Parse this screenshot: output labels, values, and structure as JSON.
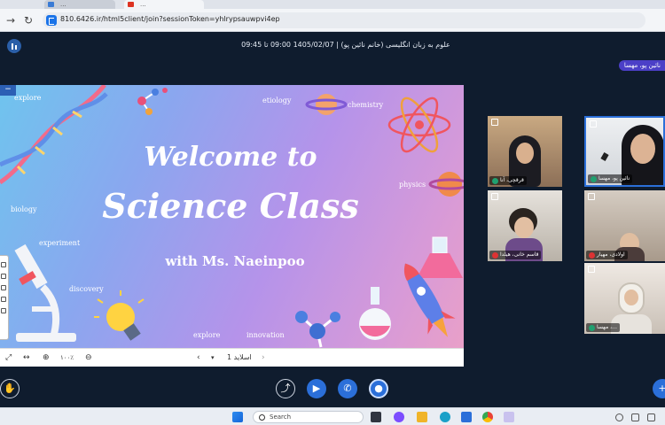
{
  "browser": {
    "tabs": [
      "...",
      "..."
    ],
    "url": "810.6426.ir/html5client/join?sessionToken=yhlrypsauwpvi4ep"
  },
  "header": {
    "session_title": "علوم به زبان انگلیسی (خانم نائین پو) | 1405/02/07 09:00 تا 09:45",
    "user_badge": "نائین پو، مهسا"
  },
  "slide": {
    "title_line1": "Welcome to",
    "title_line2": "Science Class",
    "subtitle": "with Ms. Naeinpoo",
    "words": [
      "explore",
      "etiology",
      "chemistry",
      "physics",
      "biology",
      "experiment",
      "discovery",
      "explore",
      "innovation"
    ]
  },
  "presentation_footer": {
    "zoom": "۱۰۰٪",
    "slide_label": "اسلاید 1"
  },
  "participants": [
    {
      "name": "قرقچی، آنا"
    },
    {
      "name": "نائین پو، مهسا"
    },
    {
      "name": "قاسم خانی، هیلدا"
    },
    {
      "name": "اولادی، مهیار"
    },
    {
      "name": "…، مهسا"
    }
  ],
  "taskbar": {
    "search_placeholder": "Search"
  },
  "colors": {
    "app_bg": "#0f1c2e",
    "accent": "#2b6fd9",
    "badge": "#4b3fc7"
  }
}
